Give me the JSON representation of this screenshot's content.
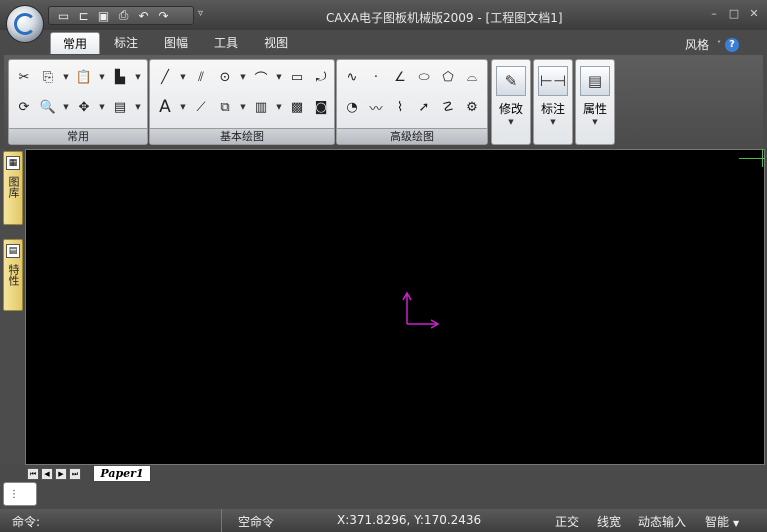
{
  "window": {
    "title": "CAXA电子图板机械版2009 - [工程图文档1]"
  },
  "qat": {
    "icons": [
      "new-file-icon",
      "open-file-icon",
      "save-icon",
      "print-icon",
      "undo-icon",
      "redo-icon"
    ]
  },
  "ribbon": {
    "tabs": [
      "常用",
      "标注",
      "图幅",
      "工具",
      "视图"
    ],
    "active_tab": "常用",
    "style_label": "风格",
    "groups": {
      "common": {
        "label": "常用"
      },
      "basic_draw": {
        "label": "基本绘图"
      },
      "advanced_draw": {
        "label": "高级绘图"
      }
    },
    "big_buttons": {
      "modify": "修改",
      "annotate": "标注",
      "properties": "属性"
    }
  },
  "side_tabs": {
    "library": "图库",
    "properties": "特性"
  },
  "sheets": {
    "active": "Paper1"
  },
  "status": {
    "command_label": "命令:",
    "command_state": "空命令",
    "coords": "X:371.8296, Y:170.2436",
    "ortho": "正交",
    "lineweight": "线宽",
    "dynamic_input": "动态输入",
    "smart": "智能"
  },
  "colors": {
    "canvas_bg": "#000000",
    "axis": "#cc22cc",
    "cursor": "#4dbd4d",
    "chrome_dark": "#4a4a4a",
    "side_tab": "#e3c869"
  }
}
